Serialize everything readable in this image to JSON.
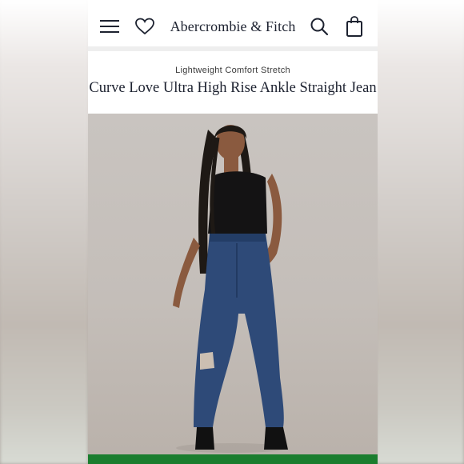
{
  "header": {
    "menu_icon": "hamburger-menu-icon",
    "wishlist_icon": "heart-icon",
    "brand": "Abercrombie & Fitch",
    "search_icon": "search-icon",
    "bag_icon": "shopping-bag-icon"
  },
  "product": {
    "subtitle": "Lightweight Comfort Stretch",
    "title": "Curve Love Ultra High Rise Ankle Straight Jean",
    "image_alt": "model wearing jeans"
  },
  "colors": {
    "brand_text": "#1d2230",
    "cta_green": "#1a7d2e",
    "denim": "#2e4a78",
    "background": "#ffffff"
  }
}
